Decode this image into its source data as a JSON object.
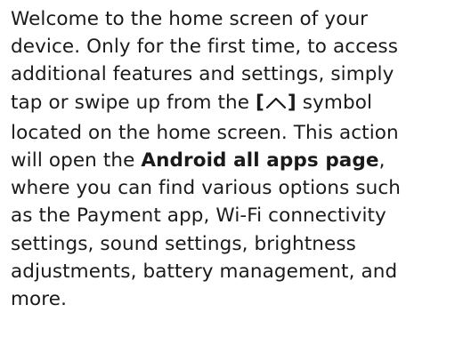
{
  "instructions": {
    "line1": "Welcome to the home screen of your",
    "line2": "device.  Only for the first time, to access",
    "line3": "additional features and settings, simply",
    "line4_before": "tap or swipe up from the ",
    "line4_bracket_open": "[",
    "line4_bracket_close": "]",
    "line4_after": " symbol",
    "line5": "located on the home screen. This action",
    "line6_before": "will open the ",
    "line6_bold": "Android all apps page",
    "line6_after": ",",
    "line7": "where you can find various options such",
    "line8": "as the Payment app, Wi-Fi connectivity",
    "line9": "settings, sound settings, brightness",
    "line10": "adjustments, battery management, and",
    "line11": "more.",
    "symbol_icon": "swipe-up-caret-icon"
  }
}
